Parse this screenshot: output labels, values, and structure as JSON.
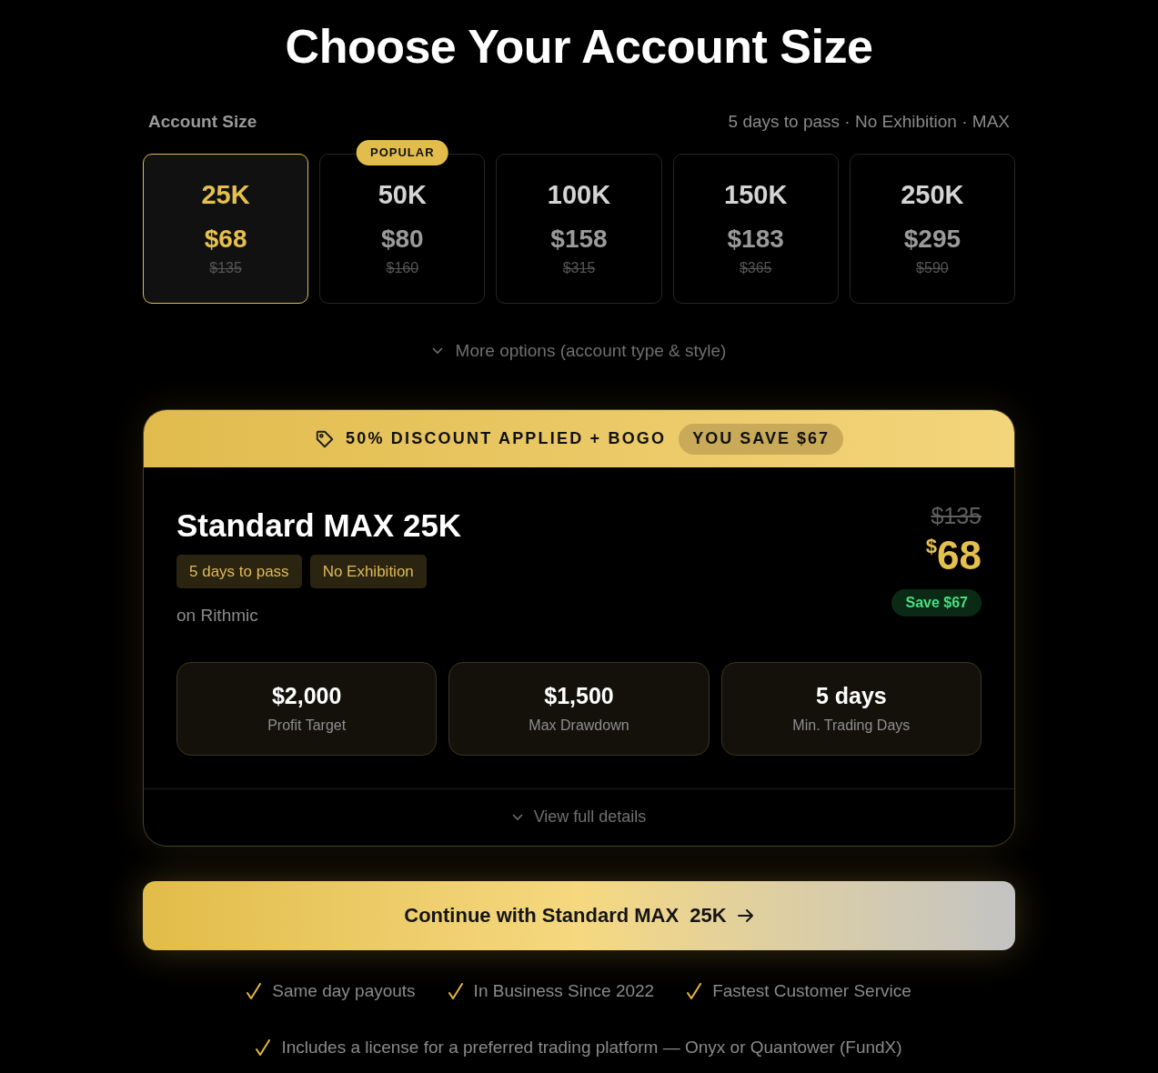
{
  "title": "Choose Your Account Size",
  "account_size": {
    "label": "Account Size",
    "summary": "5 days to pass · No Exhibition · MAX",
    "options": [
      {
        "size": "25K",
        "price": "$68",
        "original_price": "$135",
        "selected": true
      },
      {
        "size": "50K",
        "price": "$80",
        "original_price": "$160",
        "selected": false,
        "badge": "POPULAR"
      },
      {
        "size": "100K",
        "price": "$158",
        "original_price": "$315",
        "selected": false
      },
      {
        "size": "150K",
        "price": "$183",
        "original_price": "$365",
        "selected": false
      },
      {
        "size": "250K",
        "price": "$295",
        "original_price": "$590",
        "selected": false
      }
    ]
  },
  "more_options": "More options (account type & style)",
  "summary_card": {
    "banner": {
      "text": "50% DISCOUNT APPLIED + BOGO",
      "savings": "YOU SAVE $67"
    },
    "name": "Standard MAX 25K",
    "tags": [
      "5 days to pass",
      "No Exhibition"
    ],
    "platform": "on Rithmic",
    "original_price": "$135",
    "currency": "$",
    "price": "68",
    "save": "Save $67",
    "stats": [
      {
        "value": "$2,000",
        "label": "Profit Target"
      },
      {
        "value": "$1,500",
        "label": "Max Drawdown"
      },
      {
        "value": "5 days",
        "label": "Min. Trading Days"
      }
    ],
    "details_link": "View full details"
  },
  "continue_button": "Continue with Standard MAX  25K",
  "feature_rows": [
    [
      "Same day payouts",
      "In Business Since 2022",
      "Fastest Customer Service"
    ],
    [
      "Includes a license for a preferred trading platform — Onyx or Quantower (FundX)"
    ]
  ]
}
